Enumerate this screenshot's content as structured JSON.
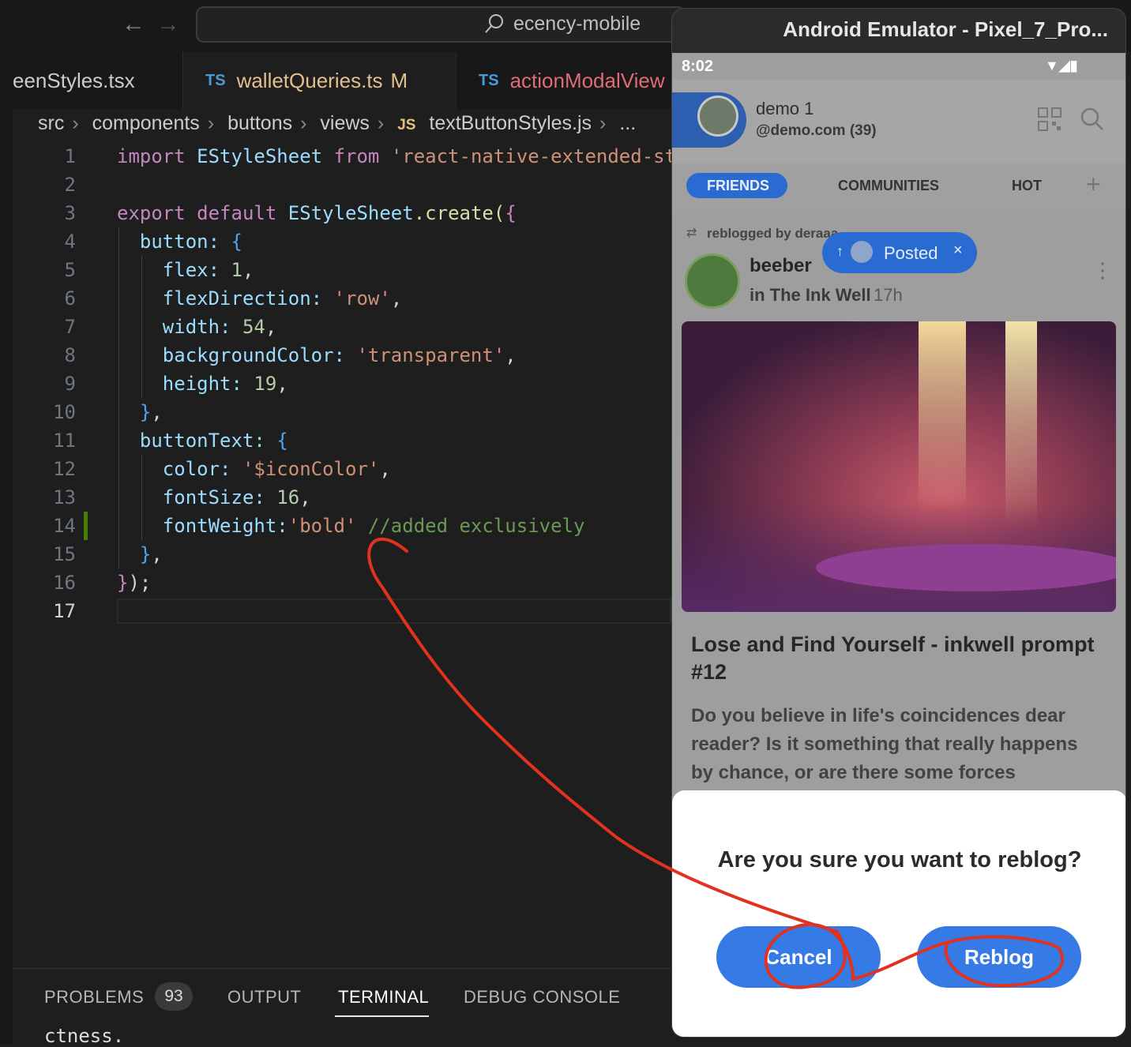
{
  "vscode": {
    "search": "ecency-mobile",
    "tabs": [
      {
        "badge": "",
        "label": "eenStyles.tsx",
        "color": "#cccccc"
      },
      {
        "badge": "TS",
        "label": "walletQueries.ts",
        "mod": "M",
        "color": "#e2c08d"
      },
      {
        "badge": "TS",
        "label": "actionModalView",
        "color": "#e06c75"
      }
    ],
    "breadcrumb": [
      "src",
      "components",
      "buttons",
      "views",
      "textButtonStyles.js",
      "..."
    ],
    "breadcrumb_badge": "JS",
    "line_numbers": [
      "1",
      "2",
      "3",
      "4",
      "5",
      "6",
      "7",
      "8",
      "9",
      "10",
      "11",
      "12",
      "13",
      "14",
      "15",
      "16",
      "17"
    ],
    "code": {
      "l1_import": "import",
      "l1_name": "EStyleSheet",
      "l1_from": "from",
      "l1_str": "'react-native-extended-st",
      "l3_export": "export",
      "l3_default": "default",
      "l3_obj": "EStyleSheet",
      "l3_create": ".create(",
      "l4_key": "button:",
      "l5_key": "flex:",
      "l5_val": "1",
      "l6_key": "flexDirection:",
      "l6_val": "'row'",
      "l7_key": "width:",
      "l7_val": "54",
      "l8_key": "backgroundColor:",
      "l8_val": "'transparent'",
      "l9_key": "height:",
      "l9_val": "19",
      "l11_key": "buttonText:",
      "l12_key": "color:",
      "l12_val": "'$iconColor'",
      "l13_key": "fontSize:",
      "l13_val": "16",
      "l14_key": "fontWeight:",
      "l14_val": "'bold'",
      "l14_cmt": "//added exclusively"
    },
    "panel_tabs": [
      "PROBLEMS",
      "OUTPUT",
      "TERMINAL",
      "DEBUG CONSOLE"
    ],
    "problems_count": "93",
    "terminal_text": "ctness."
  },
  "emulator": {
    "title": "Android Emulator - Pixel_7_Pro...",
    "time": "8:02",
    "user_name": "demo 1",
    "user_handle": "@demo.com (39)",
    "feed_tabs": [
      "FRIENDS",
      "COMMUNITIES",
      "HOT"
    ],
    "reblogged_by": "reblogged by deraaa",
    "toast": "Posted",
    "author": "beeber",
    "community": "in The Ink Well",
    "time_ago": "17h",
    "post_title": "Lose and Find Yourself - inkwell prompt #12",
    "post_excerpt": "Do you believe in life's coincidences dear reader? Is it something that really happens by chance, or are there some forces",
    "modal_question": "Are you sure you want to reblog?",
    "cancel_label": "Cancel",
    "reblog_label": "Reblog"
  },
  "colors": {
    "accent": "#357ae5",
    "annotation": "#e0321f"
  }
}
